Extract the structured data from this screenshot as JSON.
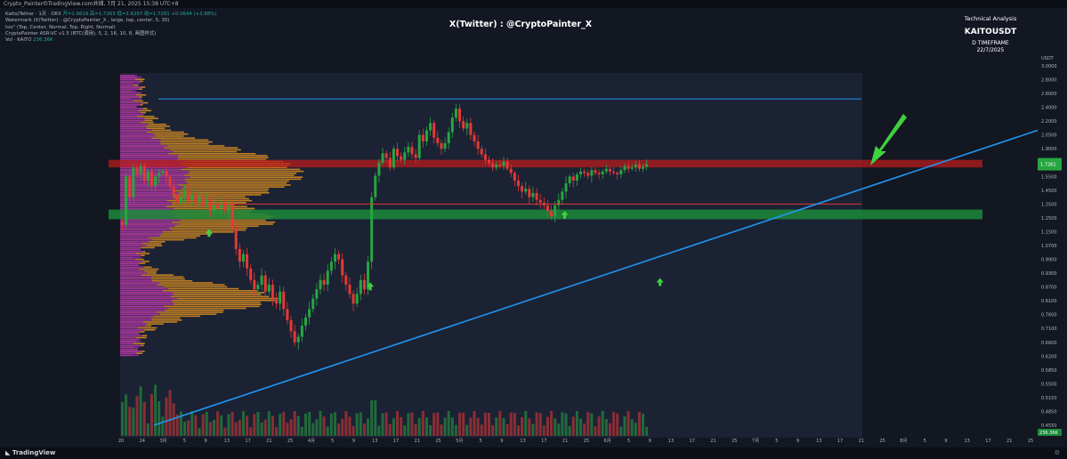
{
  "window": {
    "title": "Crypto_PainterのTradingView.com共储, 7月 21, 2025 15:38 UTC+8"
  },
  "legend": {
    "line1_prefix": "Kaito/Tether · 1天 · OKX",
    "line1_values": "开=1.6619 高=1.7263 低=1.6297 收=1.7261 +0.0644 (+3.88%)",
    "line2": "Watermark (X(Twitter) : @CryptoPainter_X , large, top, center, 5, 30)",
    "line3": "too\" (Top, Center, Normal, Top, Right, Normal)",
    "line4": "CryptoPainter ASR-VC v1.5 (BTC(调用), 5, 2, 16, 10, 8, 画图样式)",
    "line5_label": "Vol · KAITO",
    "line5_value": "236.36K"
  },
  "watermark": "X(Twitter) : @CryptoPainter_X",
  "analysis_block": {
    "line1": "Technical Analysis",
    "line2": "KAITOUSDT",
    "line3": "D TIMEFRAME",
    "line4": "22/7/2025"
  },
  "footer": {
    "logo_text": "TradingView",
    "gear": "gear-icon"
  },
  "colors": {
    "background": "#131722",
    "bull": "#26a641",
    "bear": "#e53935",
    "resistance_zone": "#b71c1c",
    "support_zone": "#1b8a3a",
    "trendline": "#2196f3",
    "arrow": "#3fd13f",
    "vp_purple": "#9c27b0",
    "vp_orange": "#e69520"
  },
  "chart_data": {
    "type": "candlestick",
    "symbol": "KAITOUSDT",
    "timeframe": "1D",
    "y_axis": {
      "currency": "USDT",
      "ticks": [
        "3.0000",
        "2.8000",
        "2.6000",
        "2.4000",
        "2.2000",
        "2.0500",
        "1.9000",
        "1.7500",
        "1.5500",
        "1.4500",
        "1.3500",
        "1.2500",
        "1.1500",
        "1.0700",
        "0.9900",
        "0.9300",
        "0.8700",
        "0.8100",
        "0.7600",
        "0.7100",
        "0.6600",
        "0.6200",
        "0.5850",
        "0.5500",
        "0.5150",
        "0.4850",
        "0.4550"
      ],
      "last_price_label": "1.7261",
      "volume_label": "236.36K"
    },
    "x_axis": {
      "ticks": [
        "20",
        "24",
        "3月",
        "5",
        "9",
        "13",
        "17",
        "21",
        "25",
        "4月",
        "5",
        "9",
        "13",
        "17",
        "21",
        "25",
        "5月",
        "5",
        "9",
        "13",
        "17",
        "21",
        "25",
        "6月",
        "5",
        "9",
        "13",
        "17",
        "21",
        "25",
        "7月",
        "5",
        "9",
        "13",
        "17",
        "21",
        "25",
        "8月",
        "5",
        "9",
        "13",
        "17",
        "21",
        "25"
      ]
    },
    "resistance_zone": [
      1.68,
      1.78
    ],
    "support_zone": [
      1.24,
      1.31
    ],
    "horizontal_line": 2.52,
    "support_line": 1.35,
    "trendline": {
      "from": [
        "2025-03-01",
        0.45
      ],
      "to": [
        "2025-08-29",
        2.1
      ]
    },
    "closes": [
      1.2,
      1.55,
      1.4,
      1.68,
      1.58,
      1.7,
      1.52,
      1.62,
      1.48,
      1.55,
      1.6,
      1.63,
      1.55,
      1.48,
      1.42,
      1.36,
      1.4,
      1.45,
      1.38,
      1.42,
      1.36,
      1.4,
      1.34,
      1.38,
      1.3,
      1.34,
      1.32,
      1.36,
      1.3,
      1.33,
      1.18,
      1.05,
      0.98,
      1.02,
      0.95,
      0.9,
      0.86,
      0.88,
      0.92,
      0.85,
      0.88,
      0.82,
      0.8,
      0.85,
      0.78,
      0.74,
      0.7,
      0.66,
      0.68,
      0.72,
      0.75,
      0.78,
      0.82,
      0.86,
      0.9,
      0.88,
      0.94,
      0.98,
      1.02,
      0.99,
      0.92,
      0.88,
      0.84,
      0.8,
      0.84,
      0.9,
      0.86,
      0.98,
      1.4,
      1.56,
      1.75,
      1.85,
      1.8,
      1.68,
      1.9,
      1.82,
      1.78,
      1.86,
      1.92,
      1.84,
      1.8,
      2.05,
      1.98,
      2.1,
      2.18,
      2.02,
      1.96,
      1.9,
      1.96,
      2.08,
      2.25,
      2.38,
      2.2,
      2.12,
      2.18,
      2.05,
      1.98,
      1.9,
      1.84,
      1.78,
      1.74,
      1.68,
      1.72,
      1.7,
      1.76,
      1.66,
      1.6,
      1.52,
      1.48,
      1.44,
      1.46,
      1.4,
      1.43,
      1.38,
      1.36,
      1.34,
      1.3,
      1.26,
      1.34,
      1.38,
      1.44,
      1.5,
      1.55,
      1.52,
      1.58,
      1.62,
      1.6,
      1.56,
      1.64,
      1.6,
      1.58,
      1.62,
      1.66,
      1.62,
      1.6,
      1.58,
      1.64,
      1.7,
      1.66,
      1.68,
      1.72,
      1.66,
      1.69,
      1.7261
    ],
    "up_arrows": [
      "2025-03-16",
      "2025-04-29",
      "2025-06-21",
      "2025-07-17"
    ],
    "down_arrow": "2025-07-21"
  }
}
